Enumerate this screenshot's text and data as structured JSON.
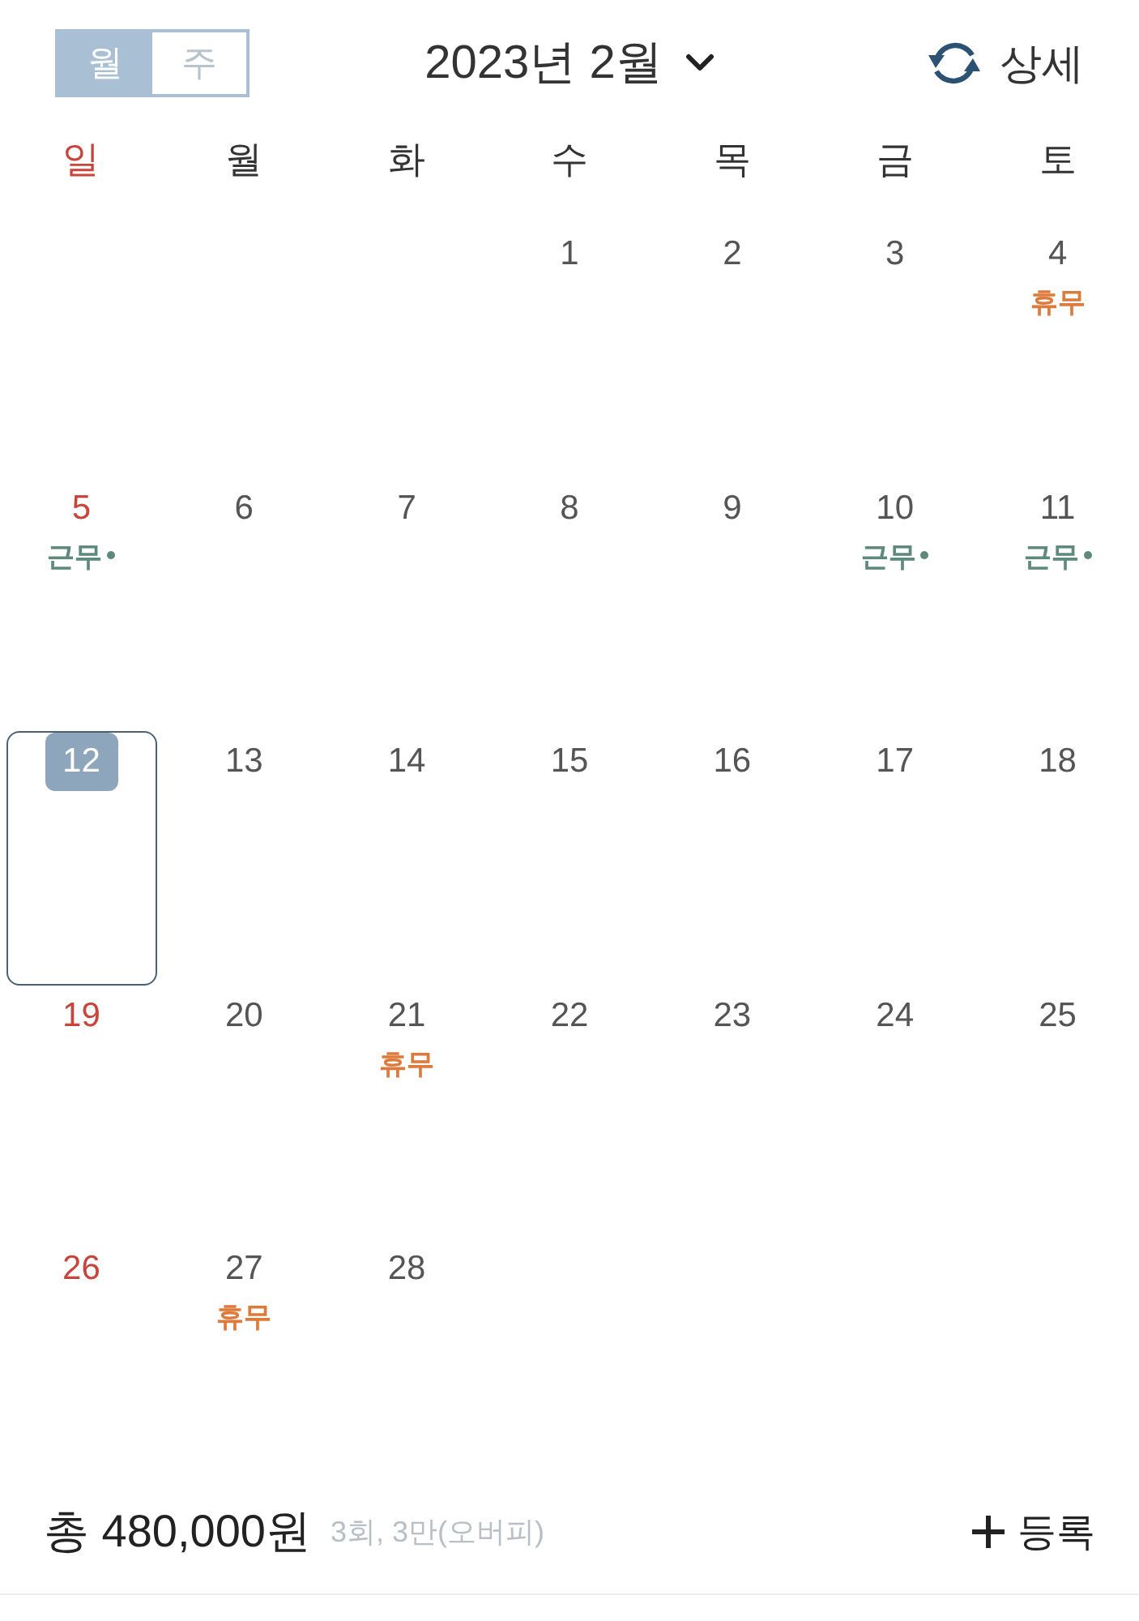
{
  "header": {
    "view_toggle": [
      {
        "label": "월",
        "selected": true
      },
      {
        "label": "주",
        "selected": false
      }
    ],
    "title": "2023년 2월",
    "detail_button": "상세"
  },
  "weekdays": [
    {
      "label": "일",
      "holiday": true
    },
    {
      "label": "월",
      "holiday": false
    },
    {
      "label": "화",
      "holiday": false
    },
    {
      "label": "수",
      "holiday": false
    },
    {
      "label": "목",
      "holiday": false
    },
    {
      "label": "금",
      "holiday": false
    },
    {
      "label": "토",
      "holiday": false
    }
  ],
  "weeks": [
    {
      "days": [
        {
          "day": "1",
          "selected": false
        },
        {
          "day": "2",
          "selected": false
        },
        {
          "day": "3",
          "selected": false
        },
        {
          "day": "4",
          "selected": false,
          "events": [
            {
              "label": "휴무",
              "color": "#dc7b3c",
              "dot": false
            }
          ]
        }
      ]
    },
    {
      "days": [
        {
          "day": "5",
          "selected": false,
          "events": [
            {
              "label": "근무",
              "color": "#5e8a7e",
              "dot": true
            }
          ]
        },
        {
          "day": "6",
          "selected": false
        },
        {
          "day": "7",
          "selected": false
        },
        {
          "day": "8",
          "selected": false
        },
        {
          "day": "9",
          "selected": false
        },
        {
          "day": "10",
          "selected": false,
          "events": [
            {
              "label": "근무",
              "color": "#5e8a7e",
              "dot": true
            }
          ]
        },
        {
          "day": "11",
          "selected": false,
          "events": [
            {
              "label": "근무",
              "color": "#5e8a7e",
              "dot": true
            }
          ]
        }
      ]
    },
    {
      "days": [
        {
          "day": "12",
          "selected": true
        },
        {
          "day": "13",
          "selected": false
        },
        {
          "day": "14",
          "selected": false
        },
        {
          "day": "15",
          "selected": false
        },
        {
          "day": "16",
          "selected": false
        },
        {
          "day": "17",
          "selected": false
        },
        {
          "day": "18",
          "selected": false
        }
      ]
    },
    {
      "days": [
        {
          "day": "19",
          "selected": false
        },
        {
          "day": "20",
          "selected": false
        },
        {
          "day": "21",
          "selected": false,
          "events": [
            {
              "label": "휴무",
              "color": "#dc7b3c",
              "dot": false
            }
          ]
        },
        {
          "day": "22",
          "selected": false
        },
        {
          "day": "23",
          "selected": false
        },
        {
          "day": "24",
          "selected": false
        },
        {
          "day": "25",
          "selected": false
        }
      ]
    },
    {
      "days": [
        {
          "day": "26",
          "selected": false
        },
        {
          "day": "27",
          "selected": false,
          "events": [
            {
              "label": "휴무",
              "color": "#dc7b3c",
              "dot": false
            }
          ]
        },
        {
          "day": "28",
          "selected": false
        }
      ]
    }
  ],
  "footer": {
    "total": "총 480,000원",
    "summary": "3회, 3만(오버피)",
    "add_button": "등록"
  }
}
